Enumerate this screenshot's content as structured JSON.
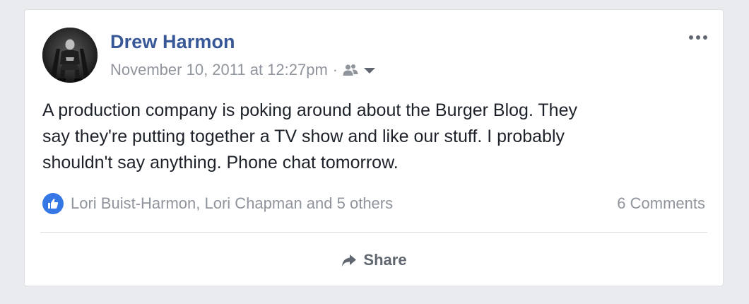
{
  "post": {
    "author": "Drew Harmon",
    "timestamp": "November 10, 2011 at 12:27pm",
    "separator": "·",
    "audience_icon": "friends-icon",
    "text": "A production company is poking around about the Burger Blog. They\nsay they're putting together a TV show and like our stuff. I probably\nshouldn't say anything. Phone chat tomorrow.",
    "reactions": {
      "icon": "like-icon",
      "names": "Lori Buist-Harmon, Lori Chapman and 5 others"
    },
    "comments": "6 Comments",
    "share_label": "Share"
  },
  "colors": {
    "author": "#385898",
    "meta": "#90949c",
    "like_badge": "#3578e5",
    "text": "#1d2129",
    "action": "#606770",
    "background": "#e9ebee"
  }
}
